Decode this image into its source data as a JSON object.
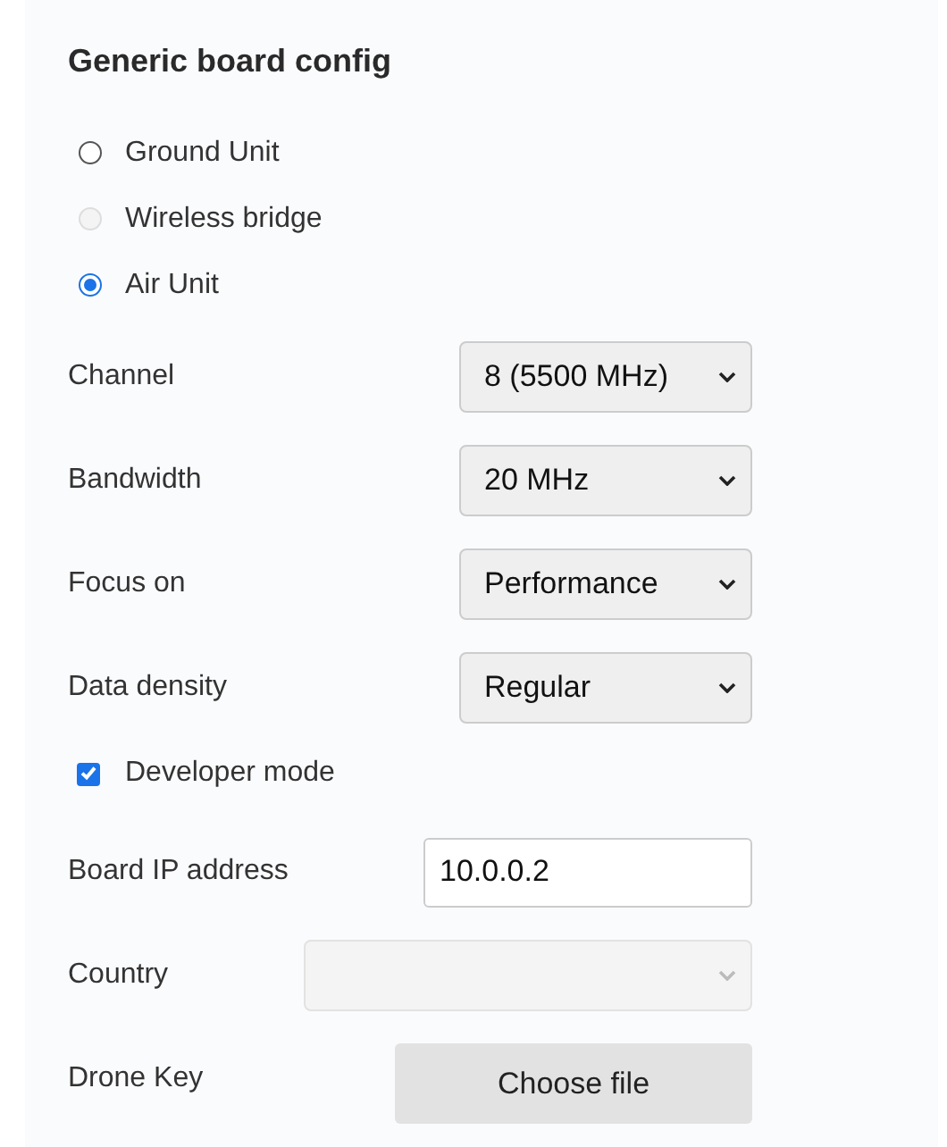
{
  "title": "Generic board config",
  "radios": [
    {
      "label": "Ground Unit",
      "selected": false,
      "disabled": false
    },
    {
      "label": "Wireless bridge",
      "selected": false,
      "disabled": true
    },
    {
      "label": "Air Unit",
      "selected": true,
      "disabled": false
    }
  ],
  "fields": [
    {
      "kind": "select",
      "label": "Channel",
      "value": "8 (5500 MHz)",
      "disabled": false
    },
    {
      "kind": "select",
      "label": "Bandwidth",
      "value": "20 MHz",
      "disabled": false
    },
    {
      "kind": "select",
      "label": "Focus on",
      "value": "Performance",
      "disabled": false
    },
    {
      "kind": "select",
      "label": "Data density",
      "value": "Regular",
      "disabled": false
    },
    {
      "kind": "checkbox",
      "label": "Developer mode",
      "checked": true
    },
    {
      "kind": "input",
      "label": "Board IP address",
      "value": "10.0.0.2"
    },
    {
      "kind": "select",
      "label": "Country",
      "disabled": true
    },
    {
      "kind": "file",
      "label": "Drone Key",
      "button": "Choose file"
    }
  ]
}
